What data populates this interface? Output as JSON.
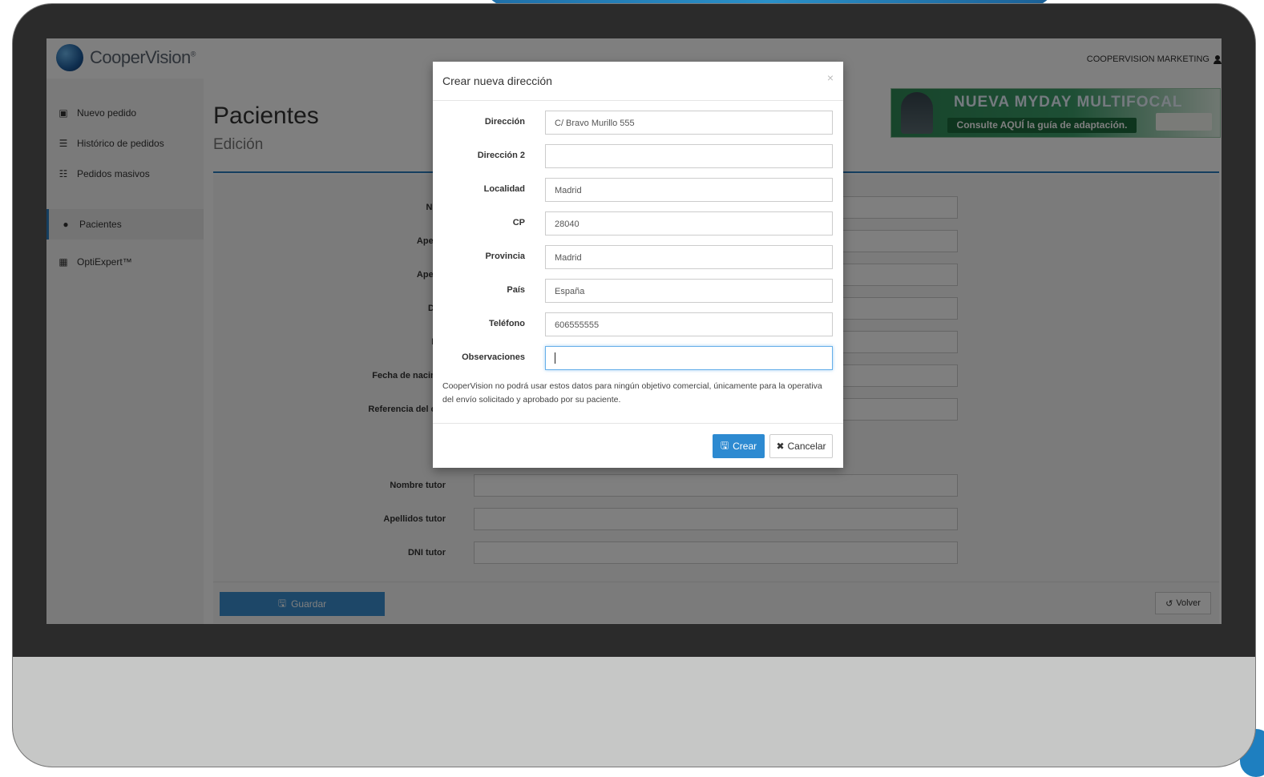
{
  "app": {
    "logo_text": "CooperVision",
    "logo_mark": "®",
    "user_name": "COOPERVISION MARKETING"
  },
  "sidebar": {
    "items": [
      {
        "label": "Nuevo pedido",
        "icon": "cart-icon",
        "active": false
      },
      {
        "label": "Histórico de pedidos",
        "icon": "list-icon",
        "active": false
      },
      {
        "label": "Pedidos masivos",
        "icon": "boxes-icon",
        "active": false
      },
      {
        "label": "Pacientes",
        "icon": "users-icon",
        "active": true
      },
      {
        "label": "OptiExpert™",
        "icon": "calculator-icon",
        "active": false
      }
    ]
  },
  "banner": {
    "title": "NUEVA MYDAY MULTIFOCAL",
    "subtitle": "Consulte AQUÍ la guía de adaptación."
  },
  "page": {
    "title": "Pacientes",
    "subtitle": "Edición"
  },
  "form": {
    "fields": [
      {
        "label": "Nom",
        "value": ""
      },
      {
        "label": "Apellic",
        "value": ""
      },
      {
        "label": "Apellic",
        "value": ""
      },
      {
        "label": "DNI/",
        "value": ""
      },
      {
        "label": "E-n",
        "value": ""
      },
      {
        "label": "Fecha de nacimie",
        "value": ""
      },
      {
        "label": "Referencia del clie",
        "value": ""
      },
      {
        "label": "Nombre tutor",
        "value": ""
      },
      {
        "label": "Apellidos tutor",
        "value": ""
      },
      {
        "label": "DNI tutor",
        "value": ""
      }
    ],
    "save_label": "Guardar",
    "back_label": "Volver"
  },
  "modal": {
    "title": "Crear nueva dirección",
    "close": "×",
    "fields": [
      {
        "label": "Dirección",
        "value": "C/ Bravo Murillo 555"
      },
      {
        "label": "Dirección 2",
        "value": ""
      },
      {
        "label": "Localidad",
        "value": "Madrid"
      },
      {
        "label": "CP",
        "value": "28040"
      },
      {
        "label": "Provincia",
        "value": "Madrid"
      },
      {
        "label": "País",
        "value": "España"
      },
      {
        "label": "Teléfono",
        "value": "606555555"
      },
      {
        "label": "Observaciones",
        "value": ""
      }
    ],
    "disclaimer": "CooperVision no podrá usar estos datos para ningún objetivo comercial, únicamente para la operativa del envío solicitado y aprobado por su paciente.",
    "create_label": "Crear",
    "cancel_label": "Cancelar"
  },
  "colors": {
    "accent": "#2d8ad1",
    "title_line": "#2b7dbf"
  }
}
